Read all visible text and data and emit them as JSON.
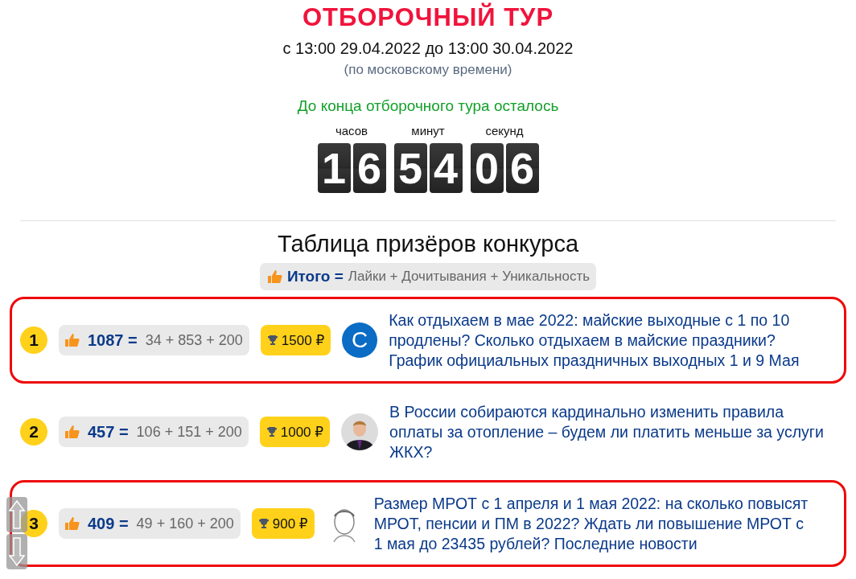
{
  "header": {
    "title": "ОТБОРОЧНЫЙ ТУР",
    "dates": "с 13:00 29.04.2022 до 13:00 30.04.2022",
    "timezone_note": "(по московскому времени)"
  },
  "countdown": {
    "caption": "До конца отборочного тура осталось",
    "units": [
      {
        "label": "часов",
        "digits": [
          "1",
          "6"
        ]
      },
      {
        "label": "минут",
        "digits": [
          "5",
          "4"
        ]
      },
      {
        "label": "секунд",
        "digits": [
          "0",
          "6"
        ]
      }
    ]
  },
  "leaderboard": {
    "heading": "Таблица призёров конкурса",
    "formula": {
      "total_label": "Итого =",
      "parts": "Лайки + Дочитывания + Уникальность"
    },
    "rows": [
      {
        "rank": "1",
        "highlighted": true,
        "total": "1087 =",
        "breakdown": "34 + 853 + 200",
        "prize": "1500 ₽",
        "avatar": {
          "kind": "letter",
          "letter": "С"
        },
        "title": "Как отдыхаем в мае 2022: майские выходные с 1 по 10 продлены? Сколько отдыхаем в майские праздники? График официальных праздничных выходных 1 и 9 Мая"
      },
      {
        "rank": "2",
        "highlighted": false,
        "total": "457 =",
        "breakdown": "106 + 151 + 200",
        "prize": "1000 ₽",
        "title": "В России собираются кардинально изменить правила оплаты за отопление – будем ли платить меньше за услуги ЖКХ?"
      },
      {
        "rank": "3",
        "highlighted": true,
        "total": "409 =",
        "breakdown": "49 + 160 + 200",
        "prize": "900 ₽",
        "avatar": {
          "kind": "sketch"
        },
        "title": "Размер МРОТ с 1 апреля и 1 мая 2022: на сколько повысят МРОТ, пенсии и ПМ в 2022? Ждать ли повышение МРОТ с 1 мая до 23435 рублей? Последние новости"
      }
    ]
  }
}
